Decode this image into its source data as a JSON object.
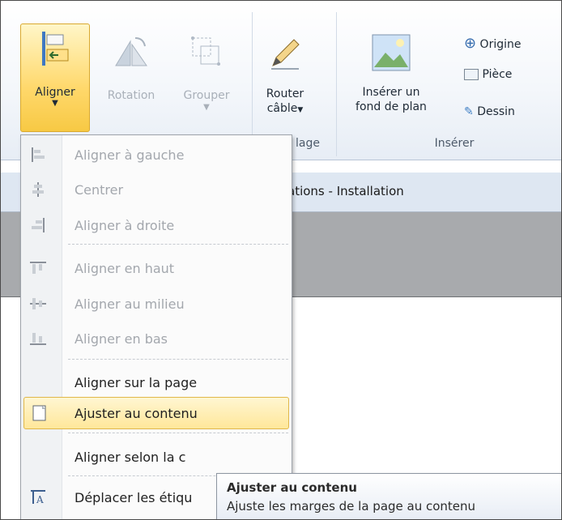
{
  "ribbon": {
    "buttons": {
      "aligner": "Aligner",
      "rotation": "Rotation",
      "grouper": "Grouper",
      "router_line1": "Router",
      "router_line2": "câble",
      "insert_line1": "Insérer un",
      "insert_line2": "fond de plan",
      "origine": "Origine",
      "piece": "Pièce",
      "dessin": "Dessin"
    },
    "group_labels": {
      "routage": "lage",
      "inserer": "Insérer"
    }
  },
  "titlebar": {
    "text": "ations - Installation"
  },
  "menu": {
    "items": [
      {
        "label": "Aligner à gauche",
        "icon": "align-left-icon"
      },
      {
        "label": "Centrer",
        "icon": "align-center-icon"
      },
      {
        "label": "Aligner à droite",
        "icon": "align-right-icon"
      },
      {
        "label": "Aligner en haut",
        "icon": "align-top-icon"
      },
      {
        "label": "Aligner au milieu",
        "icon": "align-middle-icon"
      },
      {
        "label": "Aligner en bas",
        "icon": "align-bottom-icon"
      },
      {
        "label": "Aligner sur la page",
        "icon": ""
      },
      {
        "label": "Ajuster au contenu",
        "icon": "fit-content-icon"
      },
      {
        "label": "Aligner selon la c",
        "icon": ""
      },
      {
        "label": "Déplacer les étiqu",
        "icon": "move-labels-icon"
      }
    ]
  },
  "tooltip": {
    "title": "Ajuster au contenu",
    "description": "Ajuste les marges de la page au contenu"
  },
  "colors": {
    "highlight": "#ffd86b",
    "ribbon_bg": "#f4f7fb",
    "disabled_text": "#a3a7ad"
  }
}
